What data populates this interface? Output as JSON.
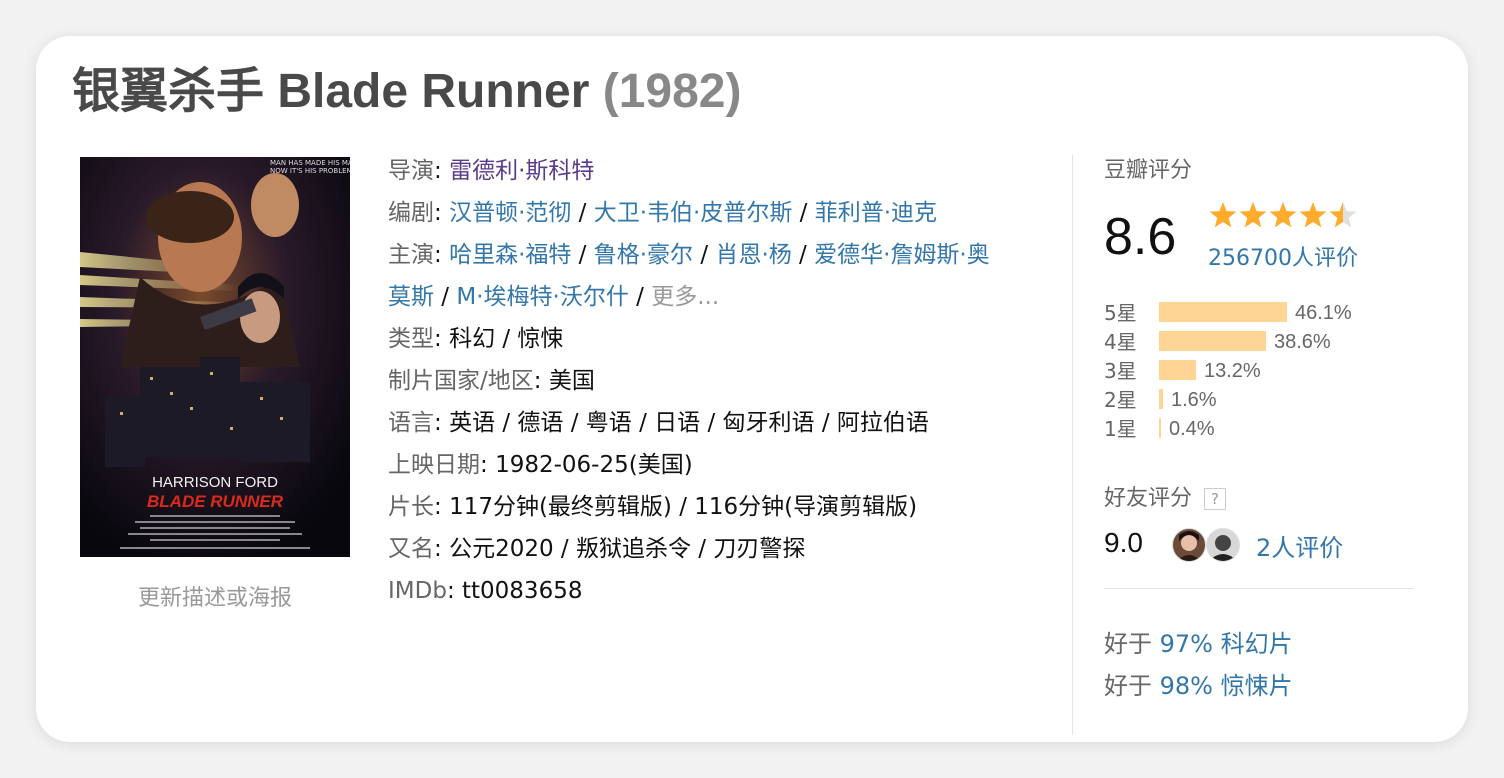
{
  "title": {
    "name": "银翼杀手 Blade Runner",
    "year": "(1982)"
  },
  "poster": {
    "tagline_1": "MAN HAS MADE HIS MATCH",
    "tagline_2": "NOW IT'S HIS PROBLEM",
    "actor": "HARRISON FORD",
    "film": "BLADE RUNNER",
    "update_link": "更新描述或海报"
  },
  "info": {
    "director_label": "导演",
    "director": "雷德利·斯科特",
    "writers_label": "编剧",
    "writers": [
      "汉普顿·范彻",
      "大卫·韦伯·皮普尔斯",
      "菲利普·迪克"
    ],
    "cast_label": "主演",
    "cast_line1": [
      "哈里森·福特",
      "鲁格·豪尔",
      "肖恩·杨",
      "爱德华·詹姆斯·奥"
    ],
    "cast_line2": [
      "莫斯",
      "M·埃梅特·沃尔什"
    ],
    "cast_more": "更多...",
    "genre_label": "类型",
    "genre": "科幻 / 惊悚",
    "country_label": "制片国家/地区",
    "country": "美国",
    "language_label": "语言",
    "language": "英语 / 德语 / 粤语 / 日语 / 匈牙利语 / 阿拉伯语",
    "release_label": "上映日期",
    "release": "1982-06-25(美国)",
    "runtime_label": "片长",
    "runtime": "117分钟(最终剪辑版) / 116分钟(导演剪辑版)",
    "aka_label": "又名",
    "aka": "公元2020 / 叛狱追杀令 / 刀刃警探",
    "imdb_label": "IMDb",
    "imdb": "tt0083658"
  },
  "rating": {
    "label": "豆瓣评分",
    "score": "8.6",
    "stars": 4.5,
    "count": "256700人评价",
    "distribution": [
      {
        "label": "5星",
        "pct": "46.1%",
        "value": 46.1
      },
      {
        "label": "4星",
        "pct": "38.6%",
        "value": 38.6
      },
      {
        "label": "3星",
        "pct": "13.2%",
        "value": 13.2
      },
      {
        "label": "2星",
        "pct": "1.6%",
        "value": 1.6
      },
      {
        "label": "1星",
        "pct": "0.4%",
        "value": 0.4
      }
    ],
    "friends_label": "好友评分",
    "friends_help": "?",
    "friends_score": "9.0",
    "friends_count": "2人评价",
    "better_prefix": "好于",
    "better": [
      {
        "pct": "97%",
        "genre": "科幻片"
      },
      {
        "pct": "98%",
        "genre": "惊悚片"
      }
    ]
  },
  "colors": {
    "link": "#3377aa",
    "bar": "#ffd596",
    "star": "#ffac2d"
  }
}
